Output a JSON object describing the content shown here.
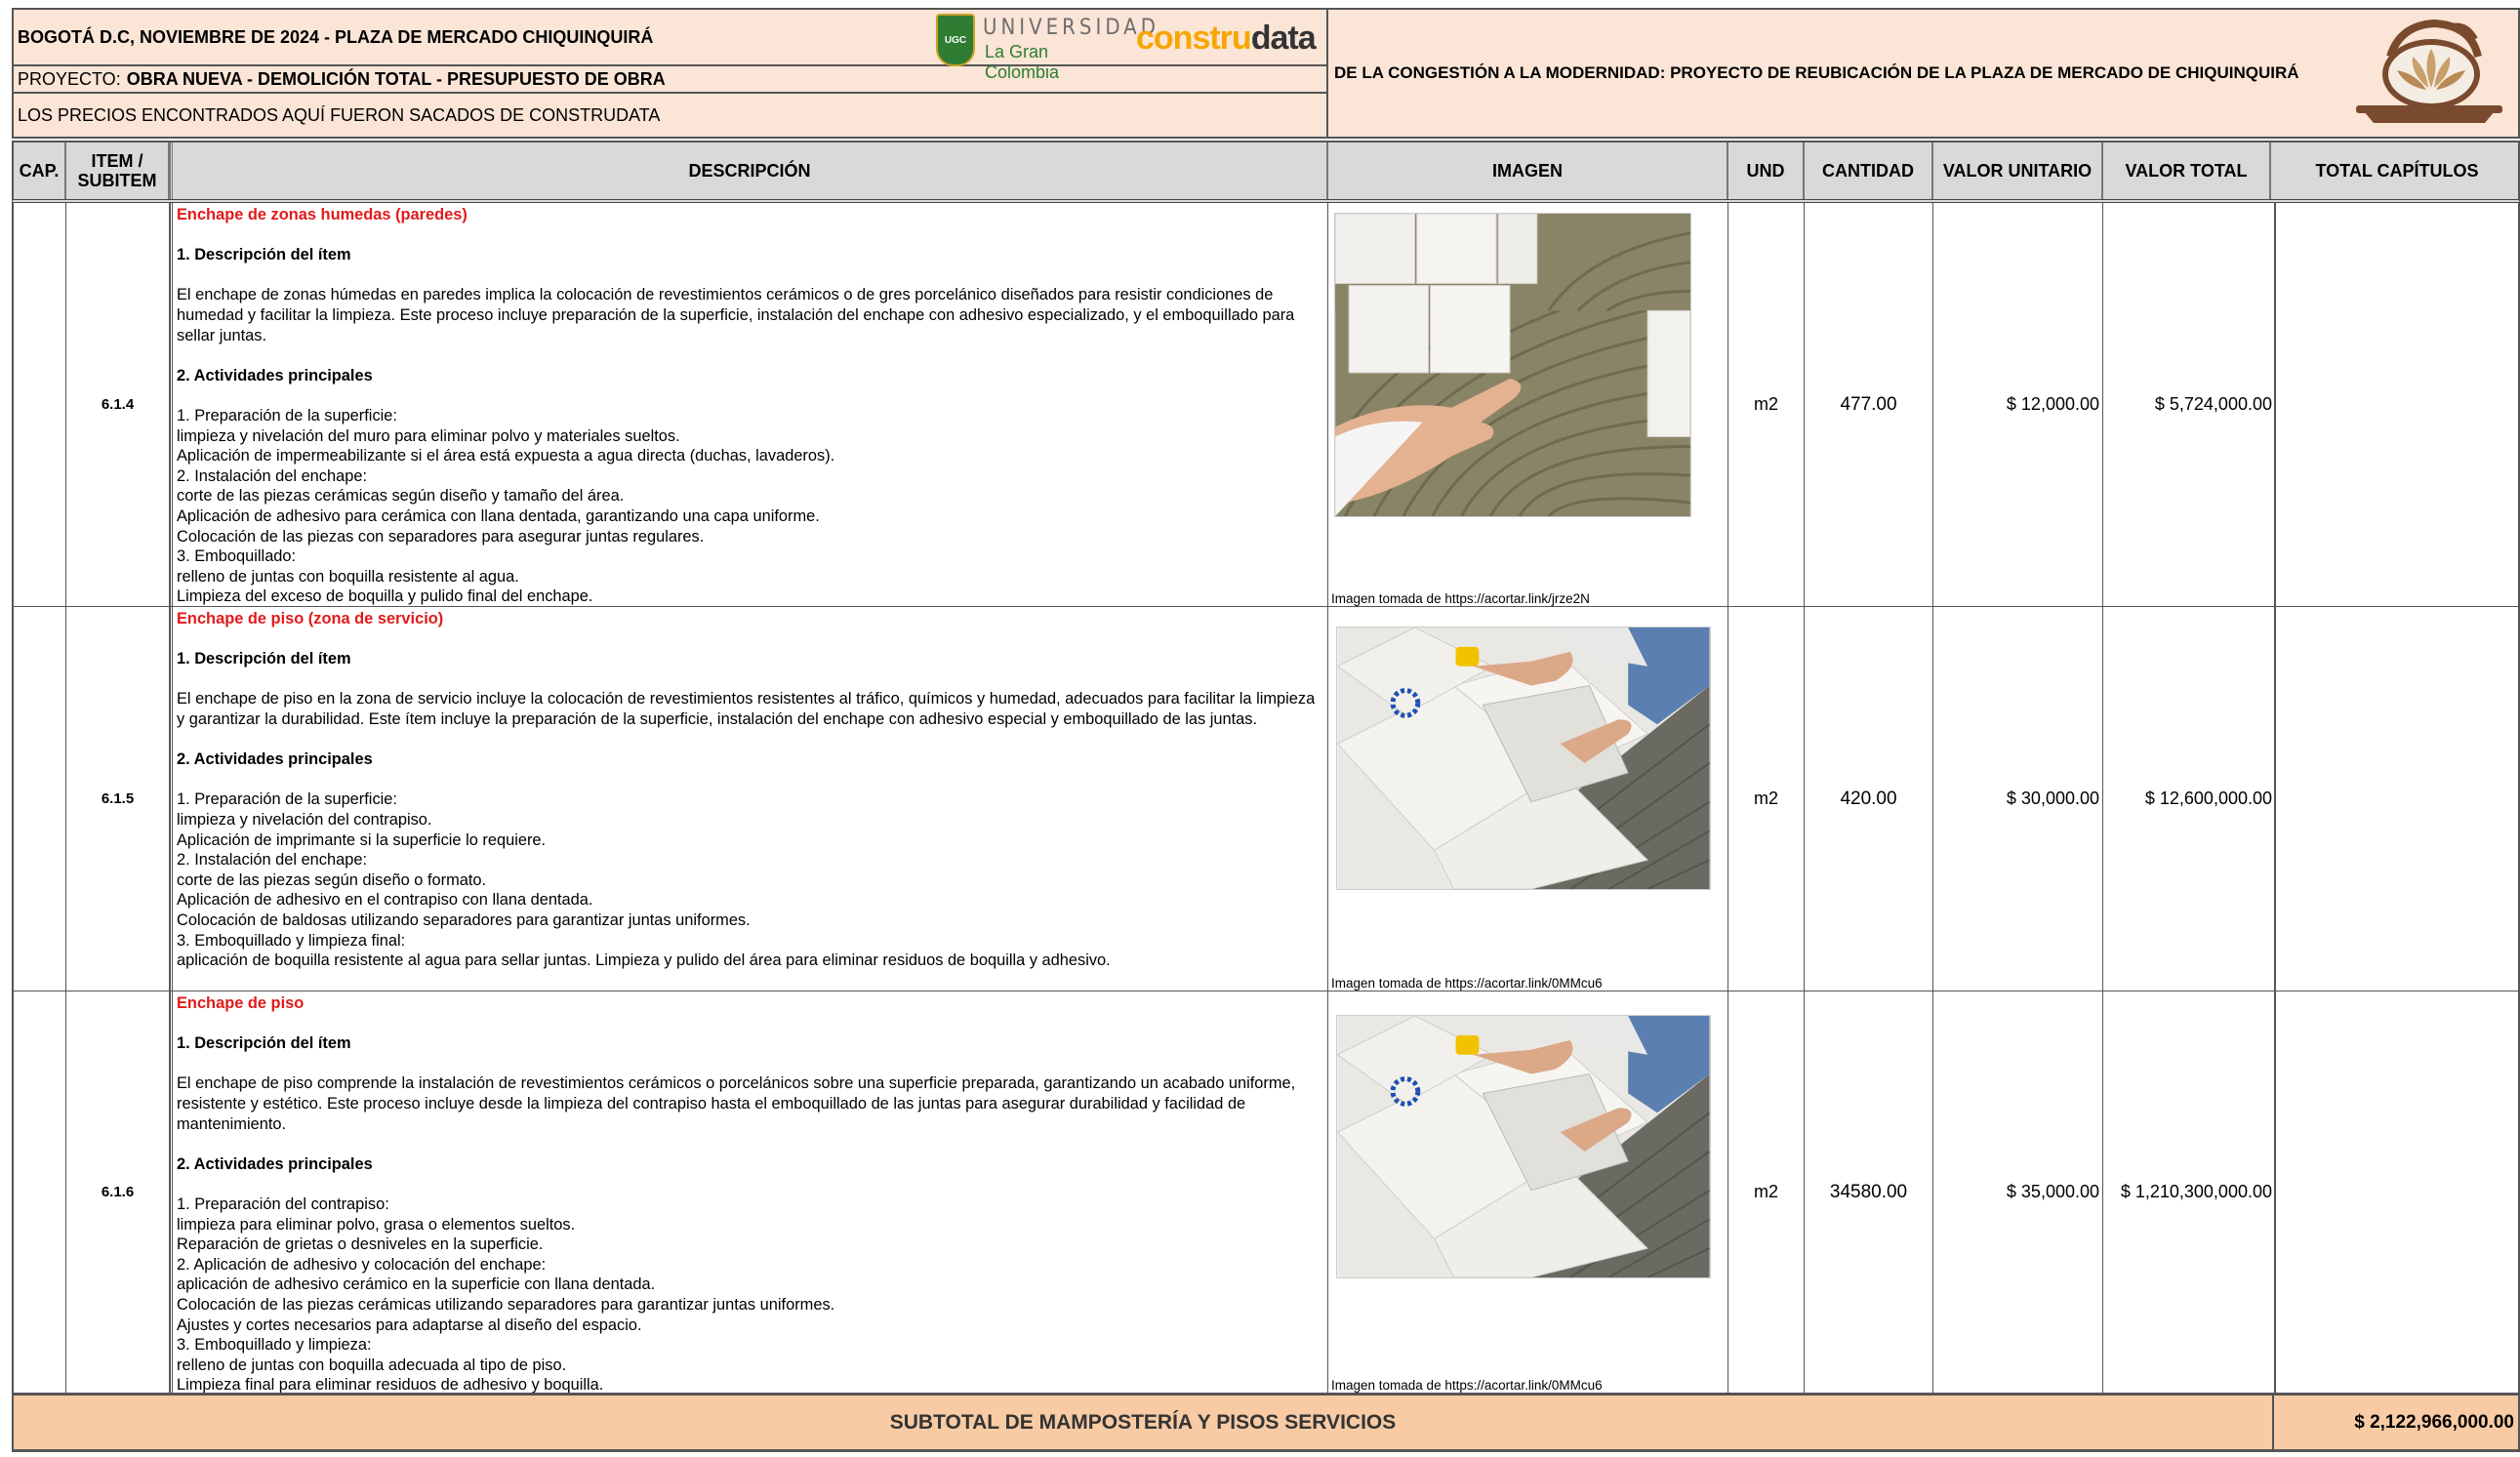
{
  "header": {
    "line1": "BOGOTÁ D.C, NOVIEMBRE DE 2024 - PLAZA DE MERCADO CHIQUINQUIRÁ",
    "project_label": "PROYECTO:",
    "project_value": "OBRA NUEVA - DEMOLICIÓN TOTAL - PRESUPUESTO DE OBRA",
    "line3": "LOS PRECIOS ENCONTRADOS AQUÍ FUERON SACADOS DE CONSTRUDATA",
    "project_title": "DE LA CONGESTIÓN A LA MODERNIDAD: PROYECTO DE REUBICACIÓN DE LA PLAZA DE MERCADO DE CHIQUINQUIRÁ",
    "ug_line1": "UNIVERSIDAD",
    "ug_line2": "La Gran Colombia",
    "ug_shield": "UGC",
    "cd_part1": "constru",
    "cd_part2": "data"
  },
  "columns": {
    "cap": "CAP.",
    "item_line1": "ITEM /",
    "item_line2": "SUBITEM",
    "desc": "DESCRIPCIÓN",
    "imagen": "IMAGEN",
    "und": "UND",
    "cantidad": "CANTIDAD",
    "valor_unitario": "VALOR UNITARIO",
    "valor_total": "VALOR TOTAL",
    "total_capitulos": "TOTAL CAPÍTULOS"
  },
  "rows": [
    {
      "item": "6.1.4",
      "title": "Enchape de zonas humedas (paredes)",
      "h1": "1. Descripción del ítem",
      "p1": "El enchape de zonas húmedas en paredes implica la colocación de revestimientos cerámicos o de gres porcelánico diseñados para resistir condiciones de humedad y facilitar la limpieza. Este proceso incluye preparación de la superficie, instalación del enchape con adhesivo especializado, y el emboquillado para sellar juntas.",
      "h2": "2. Actividades principales",
      "lines": [
        "1. Preparación de la superficie:",
        "limpieza y nivelación del muro para eliminar polvo y materiales sueltos.",
        "Aplicación de impermeabilizante si el área está expuesta a agua directa (duchas, lavaderos).",
        "2. Instalación del enchape:",
        "corte de las piezas cerámicas según diseño y tamaño del área.",
        "Aplicación de adhesivo para cerámica con llana dentada, garantizando una capa uniforme.",
        "Colocación de las piezas con separadores para asegurar juntas regulares.",
        "3. Emboquillado:",
        "relleno de juntas con boquilla resistente al agua.",
        "Limpieza del exceso de boquilla y pulido final del enchape."
      ],
      "credit": "Imagen tomada de https://acortar.link/jrze2N",
      "und": "m2",
      "cantidad": "477.00",
      "valor_unitario": "$ 12,000.00",
      "valor_total": "$ 5,724,000.00"
    },
    {
      "item": "6.1.5",
      "title": "Enchape de piso (zona de servicio)",
      "h1": "1. Descripción del ítem",
      "p1": "El enchape de piso en la zona de servicio incluye la colocación de revestimientos resistentes al tráfico, químicos y humedad, adecuados para facilitar la limpieza y garantizar la durabilidad. Este ítem incluye la preparación de la superficie, instalación del enchape con adhesivo especial y emboquillado de las juntas.",
      "h2": "2. Actividades principales",
      "lines": [
        "1. Preparación de la superficie:",
        "limpieza y nivelación del contrapiso.",
        "Aplicación de imprimante si la superficie lo requiere.",
        "2. Instalación del enchape:",
        "corte de las piezas según diseño o formato.",
        "Aplicación de adhesivo en el contrapiso con llana dentada.",
        "Colocación de baldosas utilizando separadores para garantizar juntas uniformes.",
        "3. Emboquillado y limpieza final:",
        "aplicación de boquilla resistente al agua para sellar juntas. Limpieza y pulido del área para eliminar residuos de boquilla y adhesivo."
      ],
      "credit": "Imagen tomada de https://acortar.link/0MMcu6",
      "und": "m2",
      "cantidad": "420.00",
      "valor_unitario": "$ 30,000.00",
      "valor_total": "$ 12,600,000.00"
    },
    {
      "item": "6.1.6",
      "title": "Enchape de piso",
      "h1": "1. Descripción del ítem",
      "p1": "El enchape de piso comprende la instalación de revestimientos cerámicos o porcelánicos sobre una superficie preparada, garantizando un acabado uniforme, resistente y estético. Este proceso incluye desde la limpieza del contrapiso hasta el emboquillado de las juntas para asegurar durabilidad y facilidad de mantenimiento.",
      "h2": "2. Actividades principales",
      "lines": [
        "1. Preparación del contrapiso:",
        "limpieza para eliminar polvo, grasa o elementos sueltos.",
        "Reparación de grietas o desniveles en la superficie.",
        "2. Aplicación de adhesivo y colocación del enchape:",
        "aplicación de adhesivo cerámico en la superficie con llana dentada.",
        "Colocación de las piezas cerámicas utilizando separadores para garantizar juntas uniformes.",
        "Ajustes y cortes necesarios para adaptarse al diseño del espacio.",
        "3. Emboquillado y limpieza:",
        "relleno de juntas con boquilla adecuada al tipo de piso.",
        "Limpieza final para eliminar residuos de adhesivo y boquilla."
      ],
      "credit": "Imagen tomada de https://acortar.link/0MMcu6",
      "und": "m2",
      "cantidad": "34580.00",
      "valor_unitario": "$ 35,000.00",
      "valor_total": "$ 1,210,300,000.00"
    }
  ],
  "subtotal": {
    "label": "SUBTOTAL DE MAMPOSTERÍA Y PISOS SERVICIOS",
    "value": "$ 2,122,966,000.00"
  },
  "colors": {
    "header_bg": "#fbe5d6",
    "column_header_bg": "#d9d9d9",
    "subtotal_bg": "#f8cba4",
    "item_title_red": "#e21a1a",
    "construdata_orange": "#f7a600",
    "ug_green": "#2e7d32",
    "plaza_brown": "#7a4a2e"
  }
}
